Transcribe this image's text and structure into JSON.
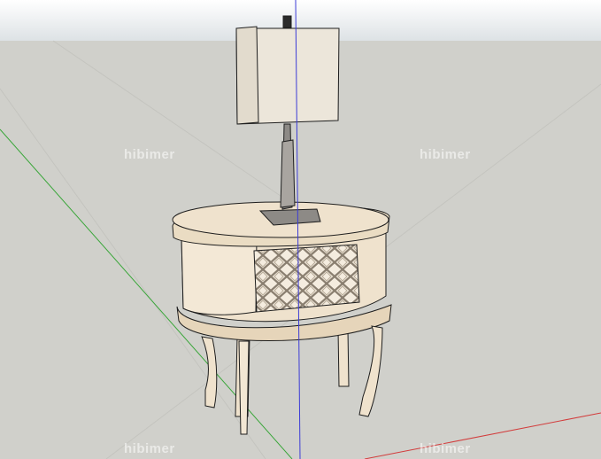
{
  "colors": {
    "sky_top": "#ffffff",
    "sky_bottom": "#dfe3e6",
    "ground": "#d0d0cb",
    "axis_blue": "#3c3cd6",
    "axis_green": "#3aa63a",
    "axis_red": "#d23c3c",
    "furniture_fill": "#efe2cd",
    "furniture_shade": "#d8c7ab",
    "edge": "#1e1e1e",
    "shade_fill": "#ece6da",
    "metal": "#8d8a86"
  },
  "watermarks": [
    {
      "text": "hibimer"
    },
    {
      "text": "hibimer"
    },
    {
      "text": "hibimer"
    },
    {
      "text": "hibimer"
    }
  ],
  "model": {
    "objects": [
      "table-lamp",
      "oval-side-table"
    ],
    "lattice_pattern": "diamond-lattice"
  }
}
